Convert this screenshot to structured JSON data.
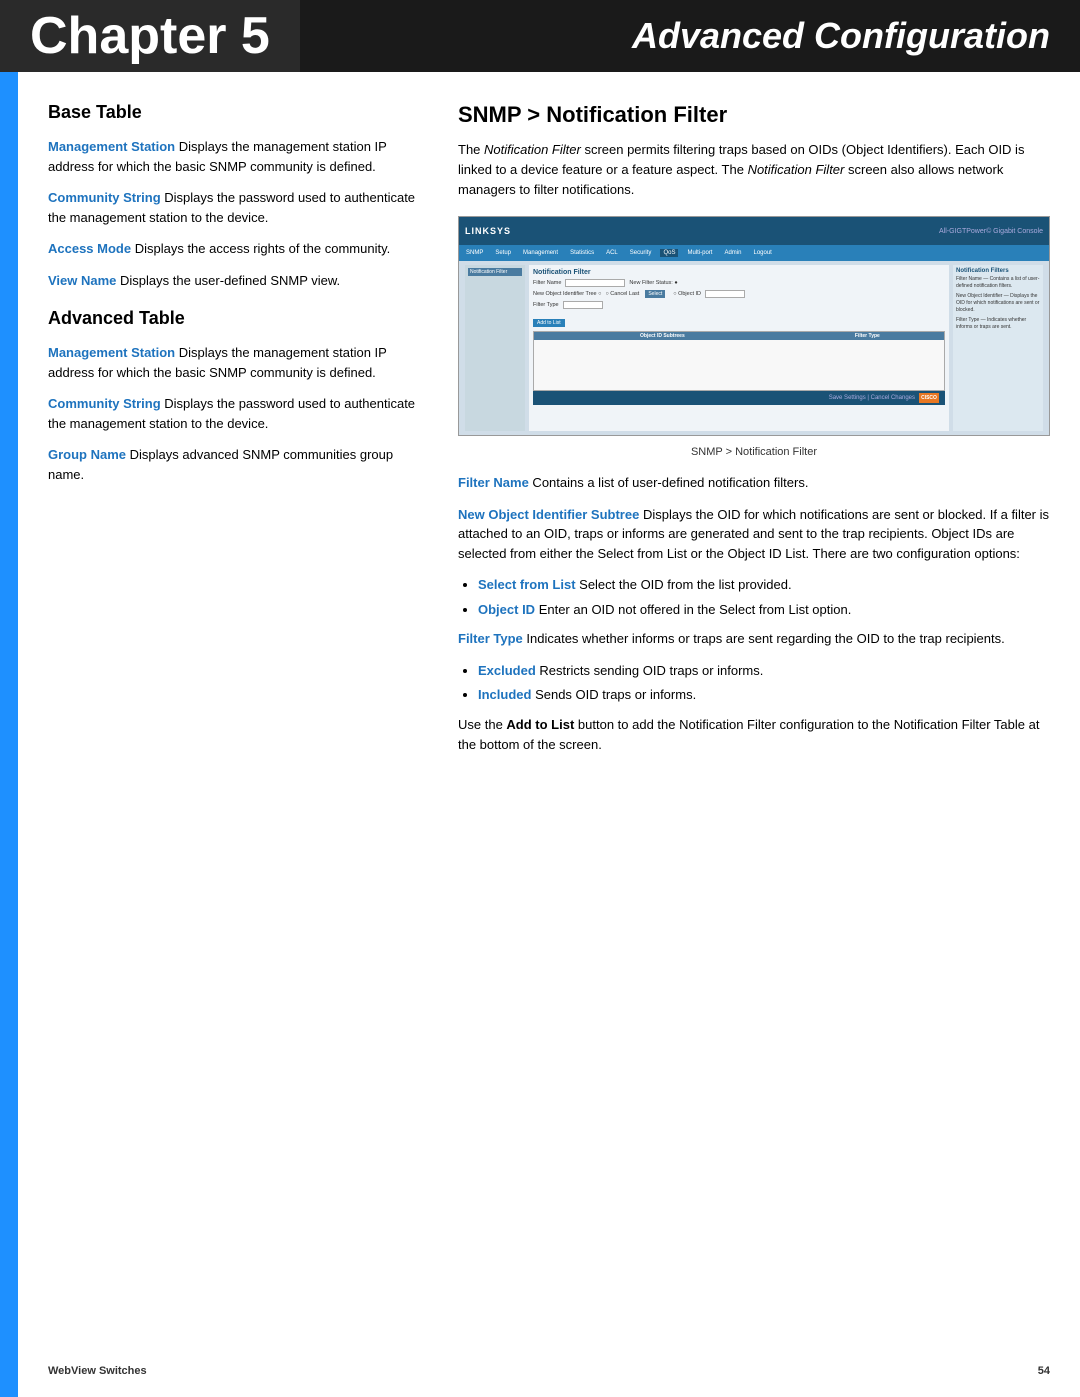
{
  "header": {
    "chapter_label": "Chapter 5",
    "title": "Advanced Configuration"
  },
  "left_column": {
    "base_table_heading": "Base Table",
    "base_table_terms": [
      {
        "term": "Management Station",
        "desc": " Displays the management station IP address for which the basic SNMP community is defined."
      },
      {
        "term": "Community String",
        "desc": " Displays the password used to authenticate the management station to the device."
      },
      {
        "term": "Access Mode",
        "desc": " Displays the access rights of the community."
      },
      {
        "term": "View Name",
        "desc": " Displays the user-defined SNMP view."
      }
    ],
    "advanced_table_heading": "Advanced Table",
    "advanced_table_terms": [
      {
        "term": "Management Station",
        "desc": " Displays the management station IP address for which the basic SNMP community is defined."
      },
      {
        "term": "Community String",
        "desc": " Displays the password used to authenticate the management station to the device."
      },
      {
        "term": "Group Name",
        "desc": " Displays advanced SNMP communities group name."
      }
    ]
  },
  "right_column": {
    "section_heading": "SNMP > Notification Filter",
    "intro_para": "The Notification Filter screen permits filtering traps based on OIDs (Object Identifiers). Each OID is linked to a device feature or a feature aspect. The Notification Filter screen also allows network managers to filter notifications.",
    "screenshot_caption": "SNMP > Notification Filter",
    "terms": [
      {
        "term": "Filter Name",
        "desc": " Contains a list of user-defined notification filters."
      },
      {
        "term": "New Object Identifier Subtree",
        "desc": " Displays the OID for which notifications are sent or blocked. If a filter is attached to an OID, traps or informs are generated and sent to the trap recipients. Object IDs are selected from either the Select from List or the Object ID List. There are two configuration options:"
      },
      {
        "term": "Select from List",
        "desc": " Select the OID from the list provided."
      },
      {
        "term": "Object ID",
        "desc": " Enter an OID not offered in the Select from List option."
      },
      {
        "term": "Filter Type",
        "desc": " Indicates whether informs or traps are sent regarding the OID to the trap recipients."
      }
    ],
    "bullet_items": [
      {
        "term": "Excluded",
        "desc": " Restricts sending OID traps or informs."
      },
      {
        "term": "Included",
        "desc": " Sends OID traps or informs."
      }
    ],
    "closing_para": "Use the Add to List button to add the Notification Filter configuration to the Notification Filter Table at the bottom of the screen."
  },
  "footer": {
    "left": "WebView Switches",
    "right": "54"
  }
}
